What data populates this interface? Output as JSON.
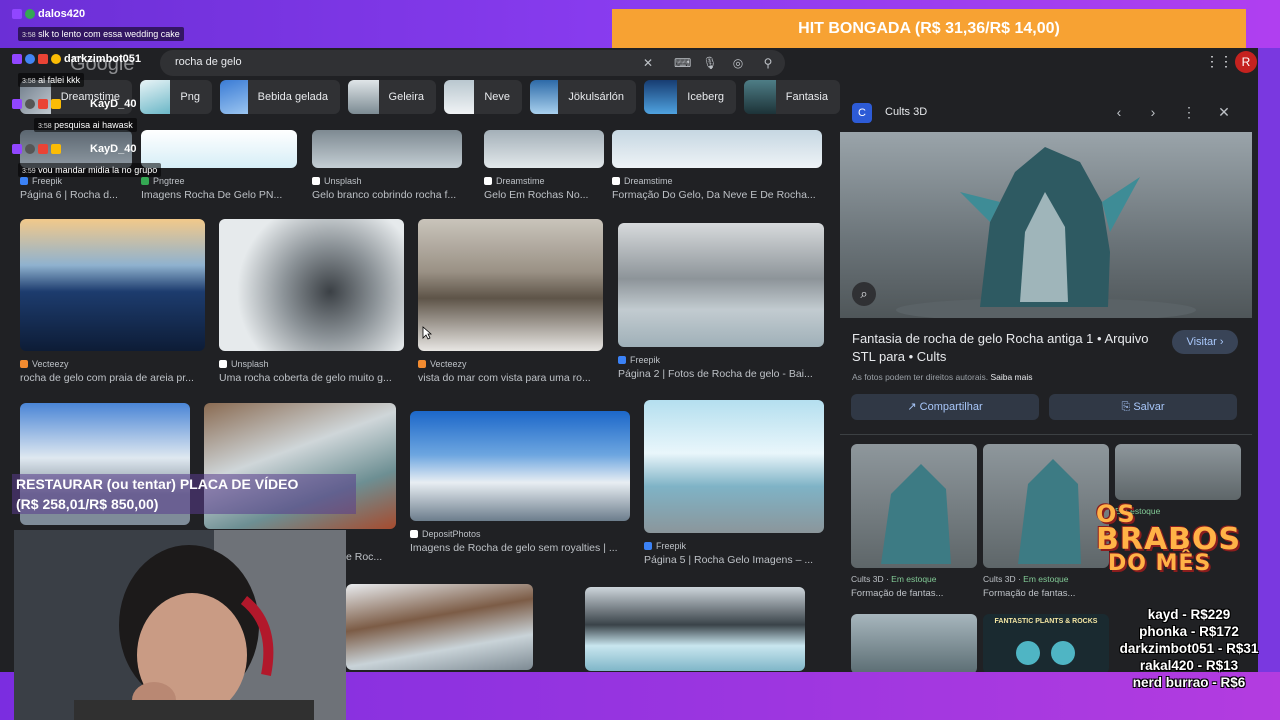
{
  "stream": {
    "hit_banner": "HIT BONGADA (R$ 31,36/R$ 14,00)",
    "restore_line1": "RESTAURAR (ou tentar) PLACA DE VÍDEO",
    "restore_line2": "(R$ 258,01/R$ 850,00)",
    "brabos_line1": "OS",
    "brabos_line2": "BRABOS",
    "brabos_line3": "DO MÊS",
    "ranking": [
      "kayd - R$229",
      "phonka - R$172",
      "darkzimbot051 - R$31",
      "rakal420 - R$13",
      "nerd burrao - R$6"
    ],
    "chat": [
      {
        "user": "dalos420",
        "time": "3:58",
        "msg": "slk to lento com essa wedding cake"
      },
      {
        "user": "darkzimbot051",
        "time": "3:58",
        "msg": "ai falei kkk"
      },
      {
        "user": "KayD_40",
        "time": "3:58",
        "msg": "pesquisa ai hawask"
      },
      {
        "user": "KayD_40",
        "time": "3:59",
        "msg": "vou mandar midia la no grupo"
      }
    ]
  },
  "google": {
    "logo": "Google",
    "query": "rocha de gelo",
    "avatar_letter": "R",
    "chips": [
      {
        "label": "Dreamstime"
      },
      {
        "label": "Png"
      },
      {
        "label": "Bebida gelada"
      },
      {
        "label": "Geleira"
      },
      {
        "label": "Neve"
      },
      {
        "label": "Jökulsárlón"
      },
      {
        "label": "Iceberg"
      },
      {
        "label": "Fantasia"
      }
    ],
    "row1": [
      {
        "source": "Freepik",
        "title": "Página 6 | Rocha d..."
      },
      {
        "source": "Pngtree",
        "title": "Imagens Rocha De Gelo PN..."
      },
      {
        "source": "Unsplash",
        "title": "Gelo branco cobrindo rocha f..."
      },
      {
        "source": "Dreamstime",
        "title": "Gelo Em Rochas No..."
      },
      {
        "source": "Dreamstime",
        "title": "Formação Do Gelo, Da Neve E De Rocha..."
      }
    ],
    "row2": [
      {
        "source": "Vecteezy",
        "title": "rocha de gelo com praia de areia pr..."
      },
      {
        "source": "Unsplash",
        "title": "Uma rocha coberta de gelo muito g..."
      },
      {
        "source": "Vecteezy",
        "title": "vista do mar com vista para uma ro..."
      },
      {
        "source": "Freepik",
        "title": "Página 2 | Fotos de Rocha de gelo - Bai..."
      }
    ],
    "row3": [
      {
        "source": "",
        "title": "e Roc..."
      },
      {
        "source": "DepositPhotos",
        "title": "Imagens de Rocha de gelo sem royalties | ..."
      },
      {
        "source": "Freepik",
        "title": "Página 5 | Rocha Gelo Imagens – ..."
      }
    ]
  },
  "panel": {
    "site": "Cults 3D",
    "title": "Fantasia de rocha de gelo Rocha antiga 1 • Arquivo STL para  • Cults",
    "visit": "Visitar ›",
    "rights": "As fotos podem ter direitos autorais.",
    "learn_more": "Saiba mais",
    "share": "Compartilhar",
    "save": "Salvar",
    "related": [
      {
        "source": "Cults 3D",
        "stock": "Em estoque",
        "title": "Formação de fantas..."
      },
      {
        "source": "Cults 3D",
        "stock": "Em estoque",
        "title": "Formação de fantas..."
      },
      {
        "source": "",
        "stock": "Em estoque",
        "title": ""
      }
    ],
    "bottom_label": "FANTASTIC PLANTS & ROCKS"
  },
  "colors": {
    "hit_bg": "#f7a233",
    "stream_purple": "#8a3cf0",
    "google_bg": "#202124"
  }
}
